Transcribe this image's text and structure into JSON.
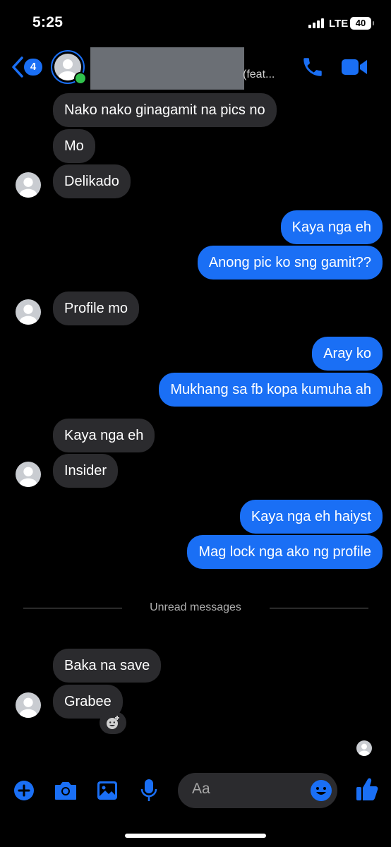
{
  "status_bar": {
    "time": "5:25",
    "network": "LTE",
    "battery": "40"
  },
  "header": {
    "unread_count": "4",
    "contact_suffix": "(feat..."
  },
  "messages": [
    {
      "dir": "in",
      "text": "Nako nako ginagamit na pics no"
    },
    {
      "dir": "in",
      "text": "Mo"
    },
    {
      "dir": "in",
      "text": "Delikado"
    },
    {
      "dir": "out",
      "text": "Kaya nga eh"
    },
    {
      "dir": "out",
      "text": "Anong pic ko sng gamit??"
    },
    {
      "dir": "in",
      "text": "Profile mo"
    },
    {
      "dir": "out",
      "text": "Aray ko"
    },
    {
      "dir": "out",
      "text": "Mukhang sa fb kopa kumuha ah"
    },
    {
      "dir": "in",
      "text": "Kaya nga eh"
    },
    {
      "dir": "in",
      "text": "Insider"
    },
    {
      "dir": "out",
      "text": "Kaya nga eh haiyst"
    },
    {
      "dir": "out",
      "text": "Mag lock nga ako ng profile"
    },
    {
      "dir": "in",
      "text": "Baka na save"
    },
    {
      "dir": "in",
      "text": "Grabee"
    }
  ],
  "divider": {
    "label": "Unread messages"
  },
  "composer": {
    "placeholder": "Aa"
  },
  "colors": {
    "accent": "#1a6ff5",
    "incoming": "#2b2b2e",
    "online": "#31c24d"
  },
  "icons": [
    "back-arrow-icon",
    "phone-icon",
    "video-camera-icon",
    "plus-icon",
    "camera-icon",
    "image-icon",
    "microphone-icon",
    "emoji-icon",
    "thumbs-up-icon",
    "add-reaction-icon"
  ]
}
